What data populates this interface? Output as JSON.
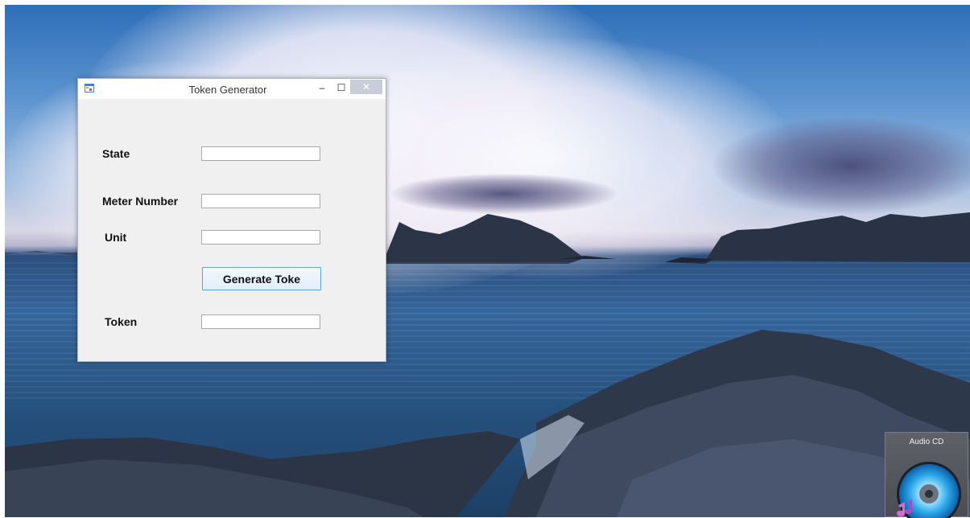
{
  "window": {
    "title": "Token Generator",
    "controls": {
      "minimize": "–",
      "maximize": "☐",
      "close": "✕"
    }
  },
  "form": {
    "state_label": "State",
    "state_value": "",
    "meter_label": "Meter Number",
    "meter_value": "",
    "unit_label": "Unit",
    "unit_value": "",
    "generate_label": "Generate Toke",
    "token_label": "Token",
    "token_value": ""
  },
  "desktop": {
    "cd_label": "Audio CD",
    "cd_icon": "audio-cd-icon"
  },
  "colors": {
    "button_border": "#5ea3dc",
    "window_bg": "#f0f0f0",
    "close_button": "#c7ced9"
  }
}
